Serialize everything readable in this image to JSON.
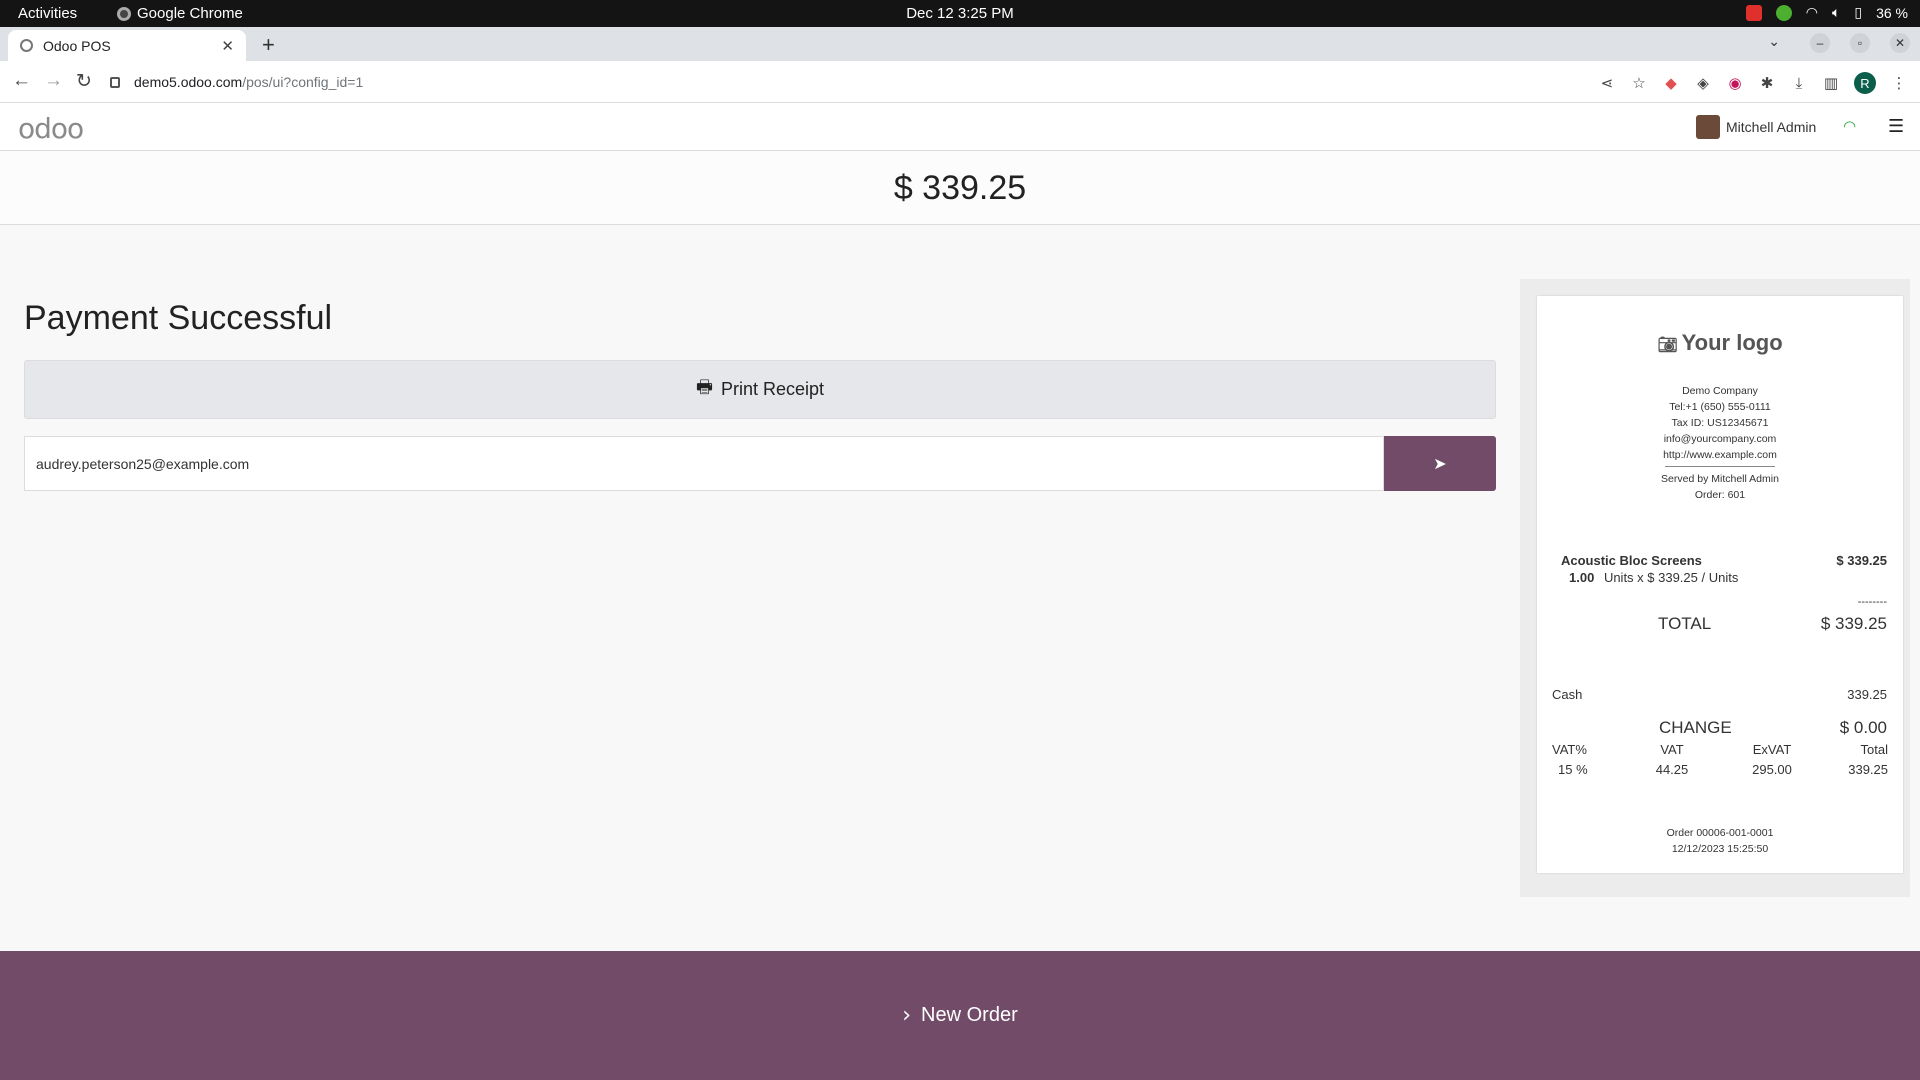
{
  "system_bar": {
    "activities": "Activities",
    "app_name": "Google Chrome",
    "clock": "Dec 12  3:25 PM",
    "battery": "36 %"
  },
  "browser": {
    "tab_title": "Odoo POS",
    "url_host": "demo5.odoo.com",
    "url_path": "/pos/ui?config_id=1",
    "profile_initial": "R"
  },
  "header": {
    "logo": "odoo",
    "user_name": "Mitchell Admin"
  },
  "amount_due": "$ 339.25",
  "main": {
    "title": "Payment Successful",
    "print_label": "Print Receipt",
    "email_value": "audrey.peterson25@example.com"
  },
  "receipt": {
    "logo_text": "Your logo",
    "company_name": "Demo Company",
    "phone": "Tel:+1 (650) 555-0111",
    "tax_id": "Tax ID: US12345671",
    "email": "info@yourcompany.com",
    "website": "http://www.example.com",
    "served_by": "Served by Mitchell Admin",
    "order_no": "Order: 601",
    "line_item": {
      "name": "Acoustic Bloc Screens",
      "price": "$ 339.25",
      "qty": "1.00",
      "detail": "Units x $ 339.25 / Units"
    },
    "subtotal_sep": "--------",
    "total_label": "TOTAL",
    "total_value": "$ 339.25",
    "payment_method": "Cash",
    "payment_amount": "339.25",
    "change_label": "CHANGE",
    "change_value": "$ 0.00",
    "tax_headers": [
      "VAT%",
      "VAT",
      "ExVAT",
      "Total"
    ],
    "tax_row": [
      "15 %",
      "44.25",
      "295.00",
      "339.25"
    ],
    "order_ref": "Order 00006-001-0001",
    "datetime": "12/12/2023 15:25:50"
  },
  "footer": {
    "new_order_label": "New Order"
  }
}
